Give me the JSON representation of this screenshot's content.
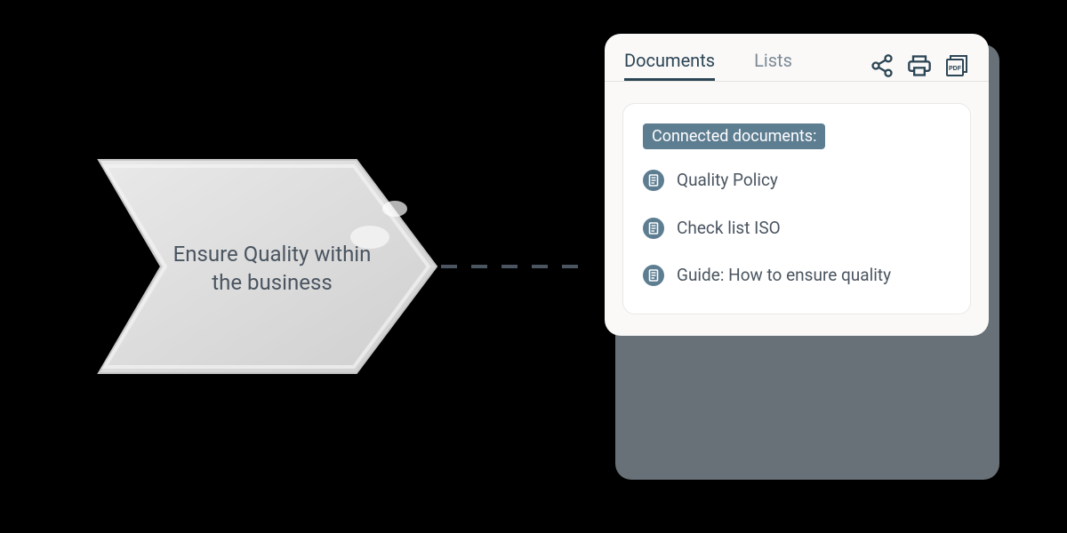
{
  "arrow": {
    "label": "Ensure Quality within the business"
  },
  "panel": {
    "tabs": [
      {
        "label": "Documents",
        "active": true
      },
      {
        "label": "Lists",
        "active": false
      }
    ],
    "actions": [
      {
        "name": "share-icon"
      },
      {
        "name": "print-icon"
      },
      {
        "name": "pdf-icon"
      }
    ],
    "section_title": "Connected documents:",
    "documents": [
      {
        "label": "Quality Policy"
      },
      {
        "label": "Check list ISO"
      },
      {
        "label": "Guide: How to ensure quality"
      }
    ]
  }
}
